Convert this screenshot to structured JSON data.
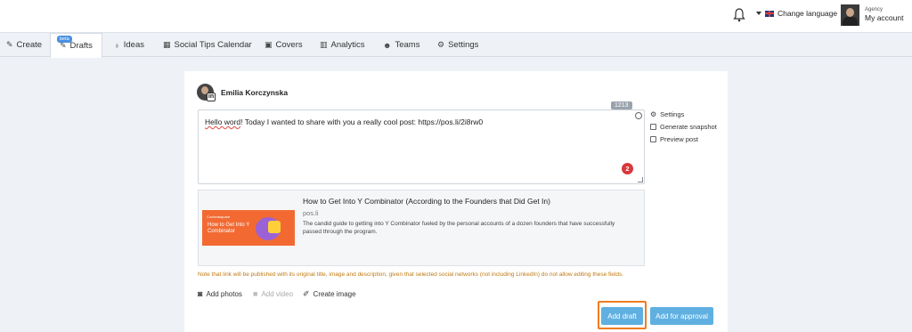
{
  "header": {
    "change_language": "Change language",
    "account_small": "Agency",
    "account_label": "My account"
  },
  "nav": {
    "tabs": [
      {
        "label": "Create",
        "icon": "edit-icon"
      },
      {
        "label": "Drafts",
        "icon": "drafts-icon",
        "badge": "beta",
        "active": true
      },
      {
        "label": "Ideas",
        "icon": "lightbulb-icon"
      },
      {
        "label": "Social Tips Calendar",
        "icon": "calendar-icon"
      },
      {
        "label": "Covers",
        "icon": "image-icon"
      },
      {
        "label": "Analytics",
        "icon": "bar-chart-icon"
      },
      {
        "label": "Teams",
        "icon": "users-icon"
      },
      {
        "label": "Settings",
        "icon": "gears-icon"
      }
    ]
  },
  "composer": {
    "author_name": "Emilia Korczynska",
    "char_count": "1213",
    "text_typo": "Hello word",
    "text_rest": "! Today I wanted to share with you a really cool post:  https://pos.li/2i8rw0",
    "error_count": "2",
    "side_actions": [
      {
        "label": "Settings",
        "icon": "gear-icon"
      },
      {
        "label": "Generate snapshot",
        "icon": "snapshot-icon"
      },
      {
        "label": "Preview post",
        "icon": "preview-icon"
      }
    ]
  },
  "link_preview": {
    "title": "How to Get Into Y Combinator (According to the Founders that Did Get In)",
    "domain": "pos.li",
    "description": "The candid guide to getting into Y Combinator fueled by the personal accounts of a dozen founders that have successfully passed through the program.",
    "thumb_brand": "Contentsquare",
    "thumb_title": "How to Get Into Y Combinator"
  },
  "note": "Note that link will be published with its original title, image and description, given that selected social networks (not including LinkedIn) do not allow editing these fields.",
  "media": {
    "add_photos": "Add photos",
    "add_video": "Add video",
    "create_image": "Create image"
  },
  "buttons": {
    "add_draft": "Add draft",
    "add_for_approval": "Add for approval"
  },
  "colors": {
    "accent": "#5fb0e0",
    "highlight": "#f07c22",
    "warning_text": "#c07a12",
    "error_badge": "#d9383a"
  }
}
